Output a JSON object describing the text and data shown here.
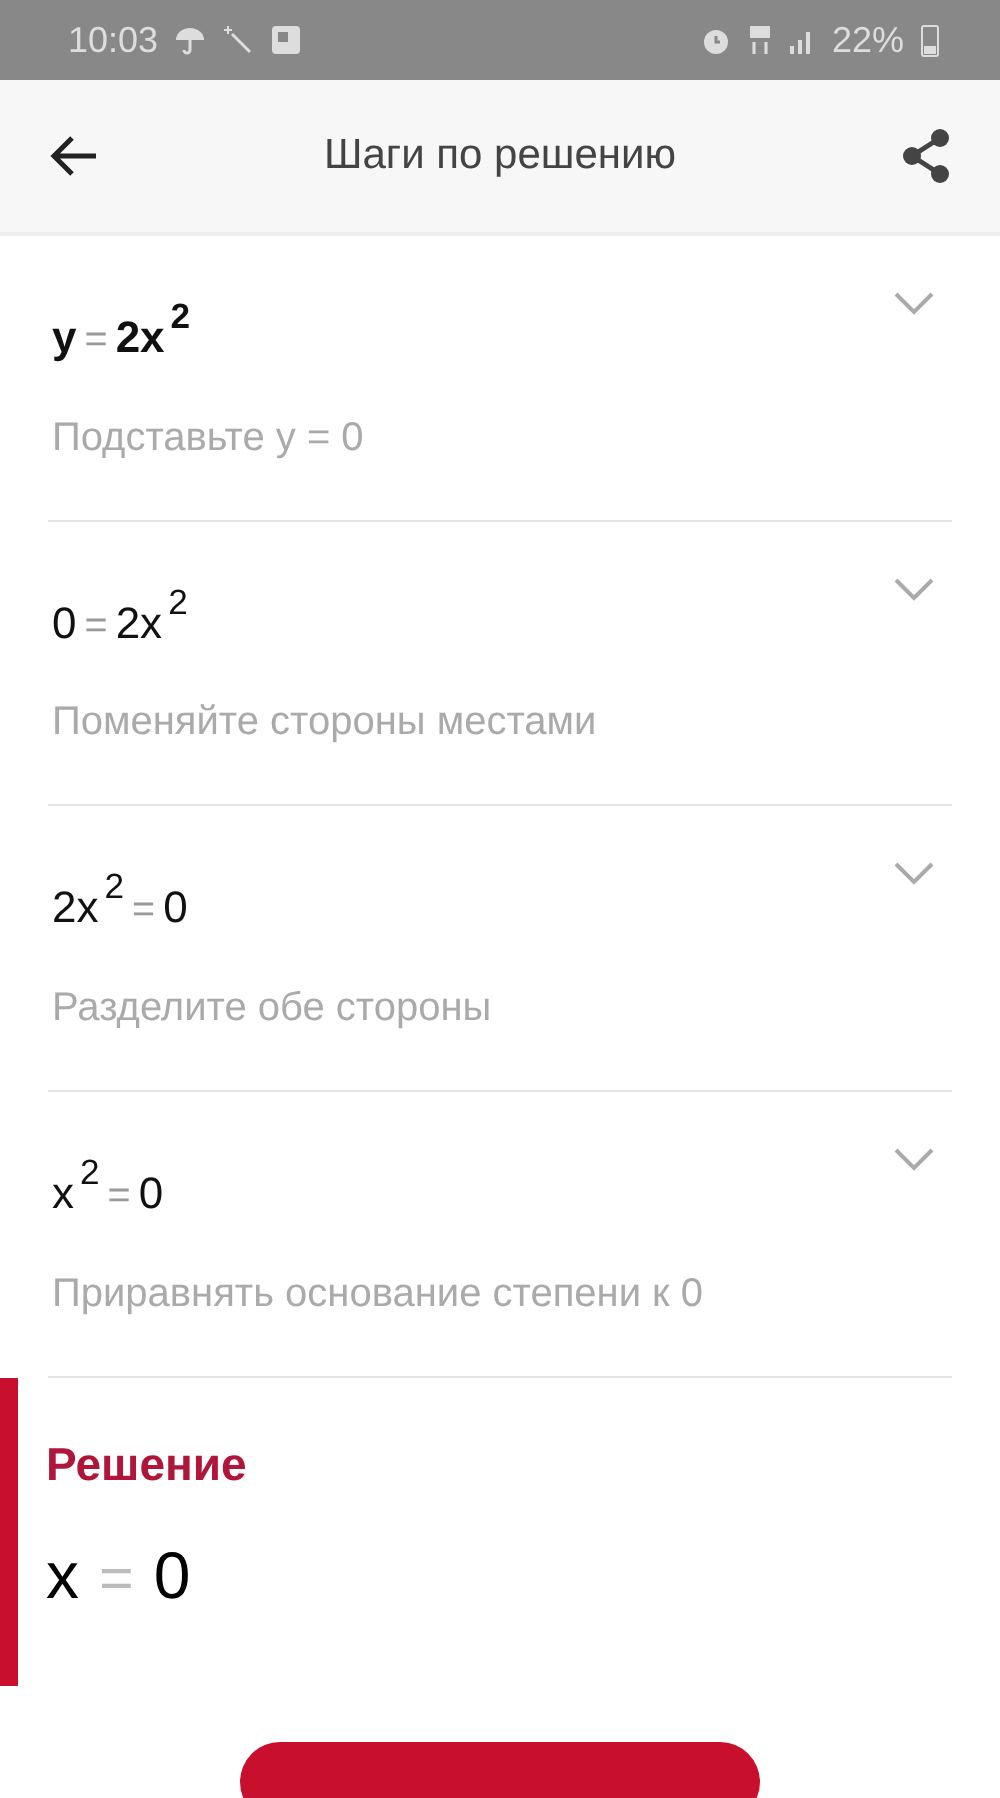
{
  "status_bar": {
    "time": "10:03",
    "battery": "22%"
  },
  "app_bar": {
    "title": "Шаги по решению"
  },
  "steps": [
    {
      "bold": true,
      "expanded": false,
      "equation": [
        {
          "kind": "term",
          "text": "y"
        },
        {
          "kind": "op",
          "text": "="
        },
        {
          "kind": "term",
          "text": "2x"
        },
        {
          "kind": "sup",
          "text": "2"
        }
      ],
      "description": "Подставьте y = 0"
    },
    {
      "bold": false,
      "expanded": false,
      "equation": [
        {
          "kind": "term",
          "text": "0"
        },
        {
          "kind": "op",
          "text": "="
        },
        {
          "kind": "term",
          "text": "2x"
        },
        {
          "kind": "sup",
          "text": "2"
        }
      ],
      "description": "Поменяйте стороны местами"
    },
    {
      "bold": false,
      "expanded": false,
      "equation": [
        {
          "kind": "term",
          "text": "2x"
        },
        {
          "kind": "sup",
          "text": "2"
        },
        {
          "kind": "op",
          "text": "="
        },
        {
          "kind": "term",
          "text": "0"
        }
      ],
      "description": "Разделите обе стороны"
    },
    {
      "bold": false,
      "expanded": false,
      "equation": [
        {
          "kind": "term",
          "text": "x"
        },
        {
          "kind": "sup",
          "text": "2"
        },
        {
          "kind": "op",
          "text": "="
        },
        {
          "kind": "term",
          "text": "0"
        }
      ],
      "description": "Приравнять основание степени к 0"
    }
  ],
  "solution": {
    "title": "Решение",
    "equation": [
      {
        "kind": "term",
        "text": "x"
      },
      {
        "kind": "op",
        "text": "="
      },
      {
        "kind": "term",
        "text": "0"
      }
    ]
  }
}
